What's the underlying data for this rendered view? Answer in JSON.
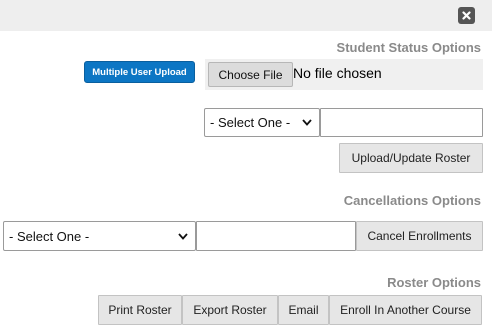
{
  "dialog": {
    "close_icon": "close-x-icon"
  },
  "student_status": {
    "heading": "Student Status Options",
    "multiple_upload_label": "Multiple User Upload",
    "file_button_label": "Choose File",
    "file_status": "No file chosen",
    "select_value": "- Select One -",
    "input_value": "",
    "upload_button_label": "Upload/Update Roster"
  },
  "cancellations": {
    "heading": "Cancellations Options",
    "select_value": "- Select One -",
    "input_value": "",
    "cancel_button_label": "Cancel Enrollments"
  },
  "roster": {
    "heading": "Roster Options",
    "buttons": [
      {
        "label": "Print Roster"
      },
      {
        "label": "Export Roster"
      },
      {
        "label": "Email"
      },
      {
        "label": "Enroll In Another Course"
      }
    ]
  },
  "colors": {
    "accent_blue": "#0c76c4",
    "heading_gray": "#8a8a8a",
    "titlebar_bg": "#eeeeee"
  }
}
